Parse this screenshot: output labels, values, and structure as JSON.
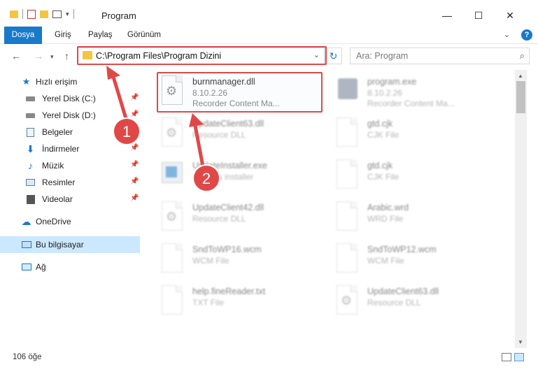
{
  "window": {
    "title": "Program",
    "minimize": "—",
    "maximize": "☐",
    "close": "✕"
  },
  "ribbon": {
    "tabs": [
      "Dosya",
      "Giriş",
      "Paylaş",
      "Görünüm"
    ],
    "help": "?"
  },
  "nav": {
    "address_path": "C:\\Program Files\\Program Dizini",
    "search_placeholder": "Ara: Program"
  },
  "sidebar": {
    "items": [
      {
        "label": "Hızlı erişim",
        "icon": "star-icon",
        "pinned": false
      },
      {
        "label": "Yerel Disk (C:)",
        "icon": "drive-icon",
        "pinned": true
      },
      {
        "label": "Yerel Disk (D:)",
        "icon": "drive-icon",
        "pinned": true
      },
      {
        "label": "Belgeler",
        "icon": "documents-icon",
        "pinned": true
      },
      {
        "label": "İndirmeler",
        "icon": "downloads-icon",
        "pinned": true
      },
      {
        "label": "Müzik",
        "icon": "music-icon",
        "pinned": true
      },
      {
        "label": "Resimler",
        "icon": "pictures-icon",
        "pinned": true
      },
      {
        "label": "Videolar",
        "icon": "videos-icon",
        "pinned": true
      },
      {
        "label": "OneDrive",
        "icon": "cloud-icon",
        "pinned": false
      },
      {
        "label": "Bu bilgisayar",
        "icon": "computer-icon",
        "pinned": false
      },
      {
        "label": "Ağ",
        "icon": "network-icon",
        "pinned": false
      }
    ]
  },
  "files": [
    {
      "name": "burnmanager.dll",
      "line1": "8.10.2.26",
      "line2": "Recorder Content Ma...",
      "icon": "dll-icon"
    },
    {
      "name": "program.exe",
      "line1": "8.10.2.26",
      "line2": "Recorder Content Ma...",
      "icon": "exe-icon"
    },
    {
      "name": "UpdateClient63.dll",
      "line1": "Resource DLL",
      "line2": "",
      "icon": "dll-icon"
    },
    {
      "name": "gtd.cjk",
      "line1": "CJK File",
      "line2": "",
      "icon": "file-icon"
    },
    {
      "name": "UpdateInstaller.exe",
      "line1": "updates installer",
      "line2": "",
      "icon": "installer-icon"
    },
    {
      "name": "gtd.cjk",
      "line1": "CJK File",
      "line2": "",
      "icon": "file-icon"
    },
    {
      "name": "UpdateClient42.dll",
      "line1": "Resource DLL",
      "line2": "",
      "icon": "dll-icon"
    },
    {
      "name": "Arabic.wrd",
      "line1": "WRD File",
      "line2": "",
      "icon": "file-icon"
    },
    {
      "name": "SndToWP16.wcm",
      "line1": "WCM File",
      "line2": "",
      "icon": "file-icon"
    },
    {
      "name": "SndToWP12.wcm",
      "line1": "WCM File",
      "line2": "",
      "icon": "file-icon"
    },
    {
      "name": "help.fineReader.txt",
      "line1": "TXT File",
      "line2": "",
      "icon": "text-icon"
    },
    {
      "name": "UpdateClient63.dll",
      "line1": "Resource DLL",
      "line2": "",
      "icon": "dll-icon"
    }
  ],
  "annotations": {
    "step1": "1",
    "step2": "2",
    "color": "#e04848"
  },
  "status": {
    "count": "106 öğe"
  }
}
